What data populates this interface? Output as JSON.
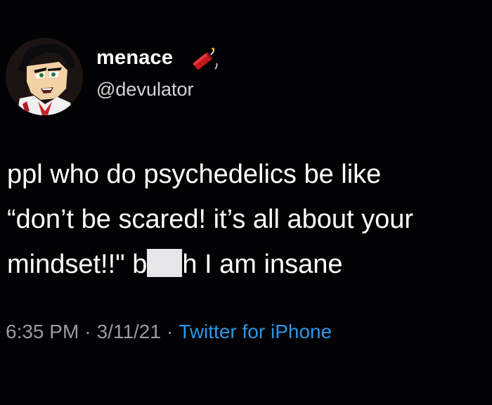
{
  "author": {
    "display_name": "menace",
    "handle": "@devulator",
    "avatar": "cartoon-avatar",
    "name_emoji": "firecracker-emoji"
  },
  "tweet": {
    "line1": "ppl who do psychedelics be like",
    "line2": "“don’t be scared! it’s all about your",
    "line3_start": "mindset!!\" b",
    "line3_end": "h I am insane"
  },
  "meta": {
    "time": "6:35 PM",
    "separator": "·",
    "date": "3/11/21",
    "source": "Twitter for iPhone"
  },
  "colors": {
    "background": "#020204",
    "text": "#ffffff",
    "secondary": "#9a9aa0",
    "link": "#2b97e6"
  }
}
